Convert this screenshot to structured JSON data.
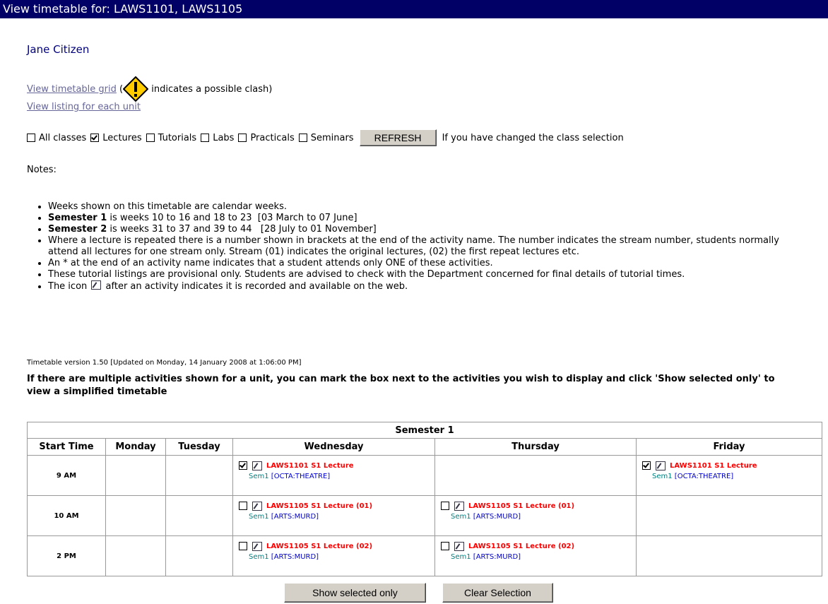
{
  "header": {
    "title": "View timetable for: LAWS1101, LAWS1105"
  },
  "student": {
    "name": "Jane Citizen"
  },
  "links": {
    "grid": "View timetable grid",
    "open_paren": "(",
    "clash_note": "indicates a possible clash)",
    "listing": "View listing for each unit"
  },
  "filters": {
    "items": [
      {
        "label": "All classes",
        "checked": false
      },
      {
        "label": "Lectures",
        "checked": true
      },
      {
        "label": "Tutorials",
        "checked": false
      },
      {
        "label": "Labs",
        "checked": false
      },
      {
        "label": "Practicals",
        "checked": false
      },
      {
        "label": "Seminars",
        "checked": false
      }
    ],
    "refresh_label": "REFRESH",
    "hint": "If you have changed the class selection"
  },
  "notes": {
    "heading": "Notes:",
    "item1": "Weeks shown on this timetable are calendar weeks.",
    "item2_bold": "Semester 1",
    "item2_rest": " is weeks 10 to 16 and 18 to 23  [03 March to 07 June]",
    "item3_bold": "Semester 2",
    "item3_rest": " is weeks 31 to 37 and 39 to 44   [28 July to 01 November]",
    "item4": "Where a lecture is repeated there is a number shown in brackets at the end of the activity name. The number indicates the stream number, students normally attend all lectures for one stream only. Stream (01) indicates the original lectures, (02) the first repeat lectures etc.",
    "item5": "An * at the end of an activity name indicates that a student attends only ONE of these activities.",
    "item6": "These tutorial listings are provisional only. Students are advised to check with the Department concerned for final details of tutorial times.",
    "item7_before": "The icon",
    "item7_after": "after an activity indicates it is recorded and available on the web."
  },
  "version": "Timetable version 1.50 [Updated on Monday, 14 January 2008 at 1:06:00 PM]",
  "instructions": "If there are multiple activities shown for a unit, you can mark the box next to the activities you wish to display and click 'Show selected only' to view a simplified timetable",
  "timetable": {
    "semester": "Semester 1",
    "columns": [
      "Start Time",
      "Monday",
      "Tuesday",
      "Wednesday",
      "Thursday",
      "Friday"
    ],
    "rows": [
      {
        "time": "9 AM",
        "wed": {
          "name": "LAWS1101 S1 Lecture",
          "sem": "Sem1",
          "loc": "[OCTA:THEATRE]",
          "checked": true
        },
        "fri": {
          "name": "LAWS1101 S1 Lecture",
          "sem": "Sem1",
          "loc": "[OCTA:THEATRE]",
          "checked": true
        }
      },
      {
        "time": "10 AM",
        "wed": {
          "name": "LAWS1105 S1 Lecture (01)",
          "sem": "Sem1",
          "loc": "[ARTS:MURD]",
          "checked": false
        },
        "thu": {
          "name": "LAWS1105 S1 Lecture (01)",
          "sem": "Sem1",
          "loc": "[ARTS:MURD]",
          "checked": false
        }
      },
      {
        "time": "2 PM",
        "wed": {
          "name": "LAWS1105 S1 Lecture (02)",
          "sem": "Sem1",
          "loc": "[ARTS:MURD]",
          "checked": false
        },
        "thu": {
          "name": "LAWS1105 S1 Lecture (02)",
          "sem": "Sem1",
          "loc": "[ARTS:MURD]",
          "checked": false
        }
      }
    ]
  },
  "buttons": {
    "show_selected": "Show selected only",
    "clear": "Clear Selection"
  },
  "icons": {
    "clash": "warning-diamond-icon",
    "recorded": "recorded-lecture-icon"
  },
  "colors": {
    "titlebar": "#000066",
    "activity": "#ff0000",
    "location": "#0000cc"
  }
}
